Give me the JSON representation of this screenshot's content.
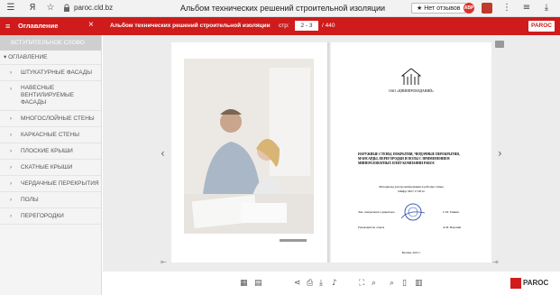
{
  "browser": {
    "yandex_glyph": "Я",
    "url": "paroc.cld.bz",
    "tab_title": "Альбом технических решений строительной изоляции",
    "reviews_label": "★ Нет отзывов",
    "abp_label": "ABP"
  },
  "header": {
    "toc_label": "Оглавление",
    "title": "Альбом технических решений строительной изоляции",
    "page_label": "стр:",
    "page_value": "2 - 3",
    "page_total": "/ 440",
    "brand_button": "PAROC"
  },
  "sidebar": {
    "intro": "ВСТУПИТЕЛЬНОЕ СЛОВО",
    "toc_head": "ОГЛАВЛЕНИЕ",
    "items": [
      {
        "label": "ШТУКАТУРНЫЕ ФАСАДЫ"
      },
      {
        "label": "НАВЕСНЫЕ ВЕНТИЛИРУЕМЫЕ ФАСАДЫ"
      },
      {
        "label": "МНОГОСЛОЙНЫЕ СТЕНЫ"
      },
      {
        "label": "КАРКАСНЫЕ СТЕНЫ"
      },
      {
        "label": "ПЛОСКИЕ КРЫШИ"
      },
      {
        "label": "СКАТНЫЕ КРЫШИ"
      },
      {
        "label": "ЧЕРДАЧНЫЕ ПЕРЕКРЫТИЯ"
      },
      {
        "label": "ПОЛЫ"
      },
      {
        "label": "ПЕРЕГОРОДКИ"
      }
    ]
  },
  "document": {
    "org": "ОАО «ЦНИИПРОМЗДАНИЙ»",
    "title": "НАРУЖНЫЕ СТЕНЫ, ПОКРЫТИЯ, ЧЕРДАЧНЫЕ ПЕРЕКРЫТИЯ, МАНСАРДЫ, ПЕРЕГОРОДКИ И ПОЛЫ С ПРИМЕНЕНИЕМ МИНЕРАЛОВАТНЫХ ПЛИТ КОМПАНИИ PAROC",
    "subtitle_1": "Материалы для проектирования и рабочие схемы",
    "subtitle_2": "Шифр: М27.17/2014",
    "sign_1_role": "Зам. генерального директора",
    "sign_1_name": "С.М. Гликин",
    "sign_2_role": "Руководитель отдела",
    "sign_2_name": "А.М. Воронин",
    "footer": "Москва, 2015 г."
  },
  "footer": {
    "brand": "PAROC"
  },
  "colors": {
    "accent": "#cf1b1b",
    "sidebar_bg": "#f4f4f4",
    "reader_bg": "#ececec"
  }
}
